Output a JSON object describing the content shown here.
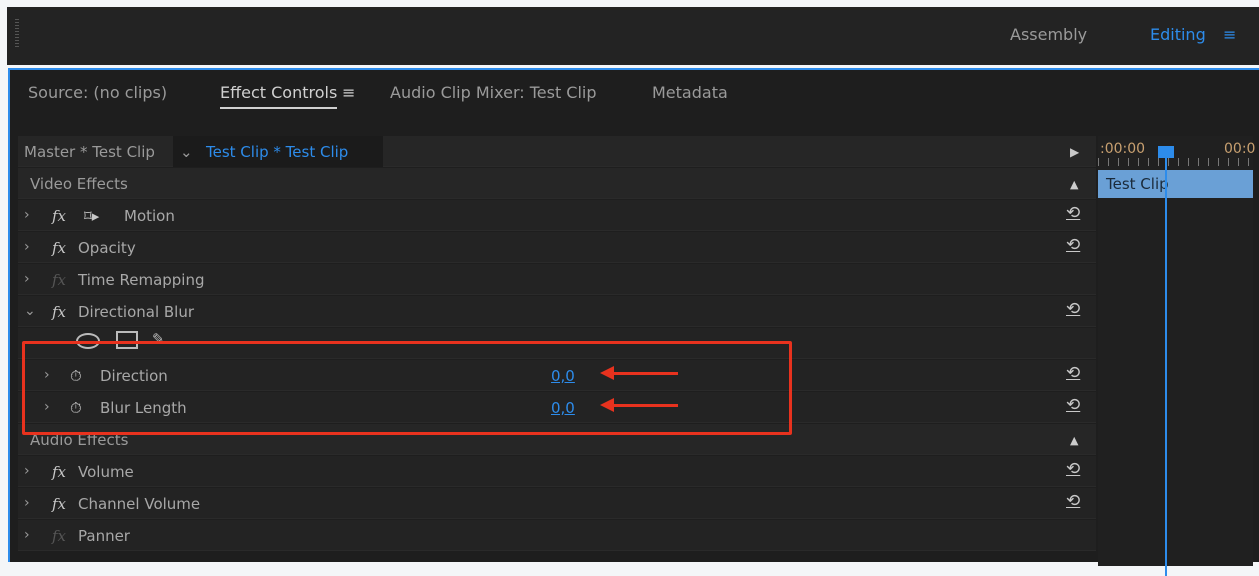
{
  "workspaces": {
    "assembly": "Assembly",
    "editing": "Editing"
  },
  "tabs": [
    "Source: (no clips)",
    "Effect Controls",
    "Audio Clip Mixer: Test Clip",
    "Metadata"
  ],
  "clip": {
    "master": "Master * Test Clip",
    "active": "Test Clip * Test Clip"
  },
  "sections": {
    "video": "Video Effects",
    "audio": "Audio Effects"
  },
  "effects": {
    "motion": "Motion",
    "opacity": "Opacity",
    "time_remap": "Time Remapping",
    "dir_blur": "Directional Blur",
    "volume": "Volume",
    "channel_volume": "Channel Volume",
    "panner": "Panner"
  },
  "params": [
    {
      "name": "Direction",
      "value": "0,0"
    },
    {
      "name": "Blur Length",
      "value": "0,0"
    }
  ],
  "timeline": {
    "time1": ":00:00",
    "time2": "00:0",
    "clip": "Test Clip"
  },
  "colors": {
    "accent": "#2d8ceb",
    "highlight": "#e8321e"
  }
}
